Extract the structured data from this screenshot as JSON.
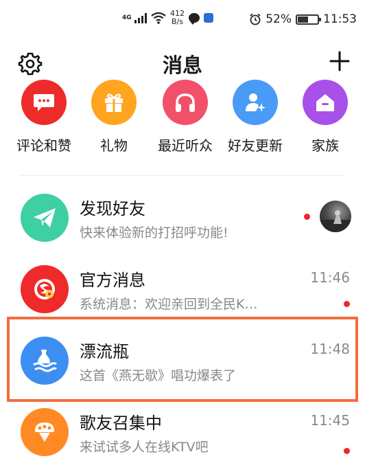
{
  "status_bar": {
    "network_type": "4G",
    "speed_value": "412",
    "speed_unit": "B/s",
    "battery_percent": "52%",
    "battery_level": 0.52,
    "time": "11:53"
  },
  "header": {
    "title": "消息",
    "settings_icon": "gear-icon",
    "add_icon": "plus-icon"
  },
  "quick_actions": [
    {
      "label": "评论和赞",
      "icon": "chat-bubble-icon",
      "color": "#ee2b2b"
    },
    {
      "label": "礼物",
      "icon": "gift-icon",
      "color": "#ffa51f"
    },
    {
      "label": "最近听众",
      "icon": "headphones-icon",
      "color": "#f2506a"
    },
    {
      "label": "好友更新",
      "icon": "user-sparkle-icon",
      "color": "#4a9bf5"
    },
    {
      "label": "家族",
      "icon": "house-icon",
      "color": "#a751e8"
    }
  ],
  "messages": [
    {
      "title": "发现好友",
      "subtitle": "快来体验新的打招呼功能!",
      "time": "",
      "avatar_icon": "paper-plane-icon",
      "avatar_color": "#3ecfa3",
      "unread": true
    },
    {
      "title": "官方消息",
      "subtitle": "系统消息：欢迎亲回到全民K…",
      "time": "11:46",
      "avatar_icon": "karaoke-logo-icon",
      "avatar_color": "#ef2a2a",
      "unread": true
    },
    {
      "title": "漂流瓶",
      "subtitle": "这首《燕无歇》唱功爆表了",
      "time": "11:48",
      "avatar_icon": "drift-bottle-icon",
      "avatar_color": "#3c8ef0",
      "unread": false
    },
    {
      "title": "歌友召集中",
      "subtitle": "来试试多人在线KTV吧",
      "time": "11:45",
      "avatar_icon": "microphone-group-icon",
      "avatar_color": "#ff8a24",
      "unread": true
    }
  ],
  "colors": {
    "highlight_border": "#f36c3d",
    "unread_dot": "#f0242a"
  }
}
